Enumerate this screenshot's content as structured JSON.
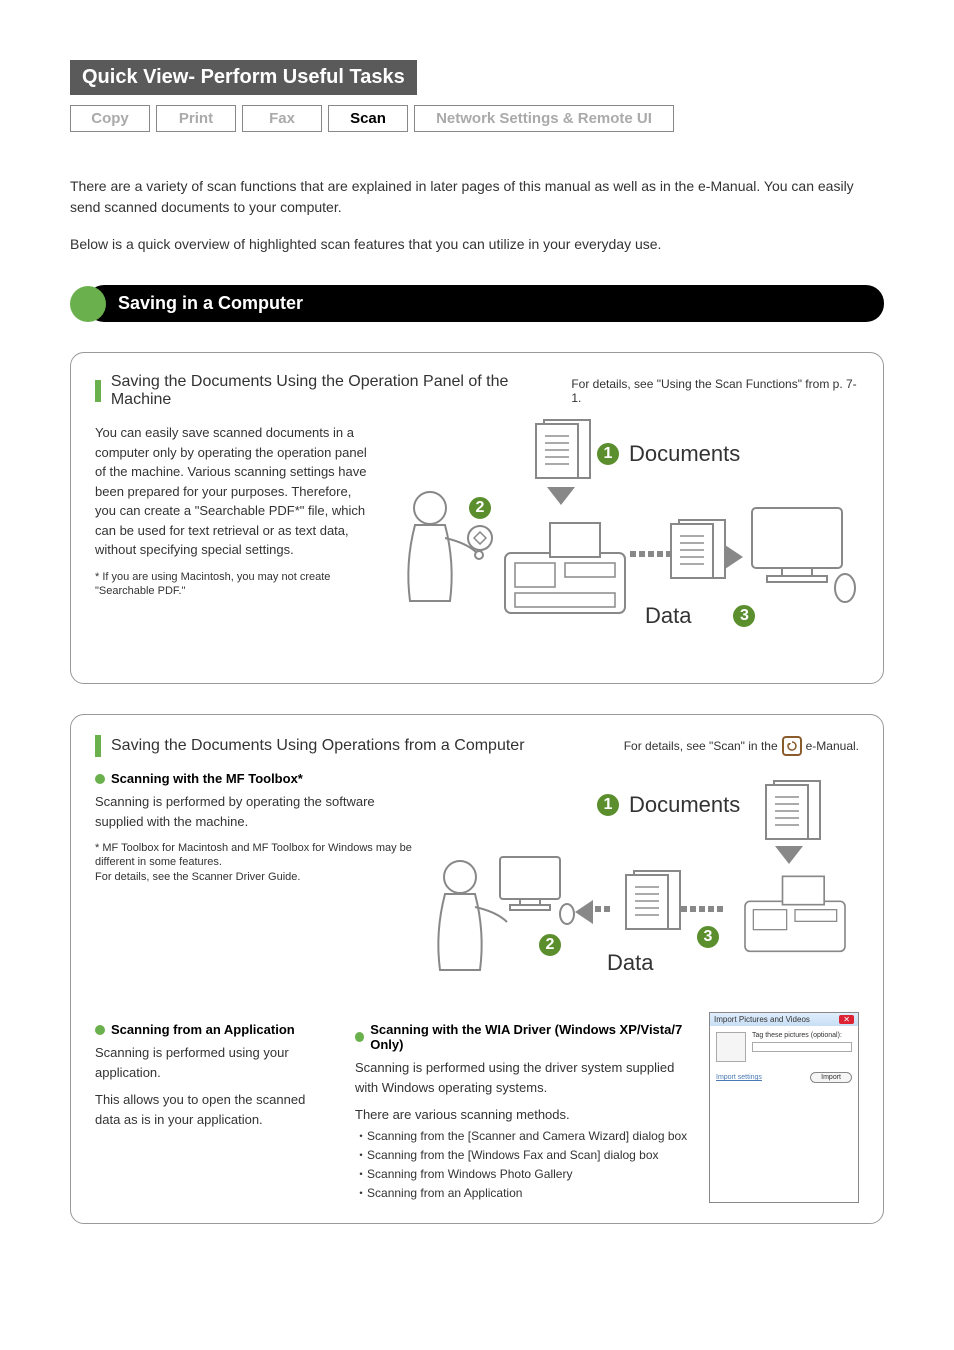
{
  "header": {
    "title": "Quick View- Perform Useful Tasks",
    "tabs": [
      "Copy",
      "Print",
      "Fax",
      "Scan",
      "Network Settings & Remote UI"
    ],
    "active_tab_index": 3
  },
  "intro": {
    "p1": "There are a variety of scan functions that are explained in later pages of this manual as well as in the e-Manual. You can easily send scanned documents to your computer.",
    "p2": "Below is a quick overview of highlighted scan features that you can utilize in your everyday use."
  },
  "section_title": "Saving in a Computer",
  "card1": {
    "title": "Saving the Documents Using the Operation Panel of the Machine",
    "detail": "For details, see \"Using the Scan Functions\" from p. 7-1.",
    "text": "You can easily save scanned documents in a computer only by operating the operation panel of the machine. Various scanning settings have been prepared for your purposes. Therefore, you can create a \"Searchable PDF*\" file, which can be used for text retrieval or as text data, without specifying special settings.",
    "footnote": "* If you are using Macintosh, you may not create \"Searchable PDF.\"",
    "label_documents": "Documents",
    "label_data": "Data",
    "n1": "1",
    "n2": "2",
    "n3": "3"
  },
  "card2": {
    "title": "Saving the Documents Using Operations from a Computer",
    "detail_pre": "For details, see \"Scan\" in the",
    "detail_post": "e-Manual.",
    "sub1_title": "Scanning with the MF Toolbox*",
    "sub1_text": "Scanning is performed by operating the software supplied with the machine.",
    "sub1_foot1": "* MF Toolbox for Macintosh and MF Toolbox for Windows may be different in some features.",
    "sub1_foot2": "  For details, see the Scanner Driver Guide.",
    "label_documents": "Documents",
    "label_data": "Data",
    "n1": "1",
    "n2": "2",
    "n3": "3",
    "subA_title": "Scanning from an Application",
    "subA_text1": "Scanning is performed using your application.",
    "subA_text2": "This allows you to open the scanned data as is in your application.",
    "subB_title": "Scanning with the WIA Driver (Windows XP/Vista/7 Only)",
    "subB_text1": "Scanning is performed using the driver system supplied with Windows operating systems.",
    "subB_text2": "There are various scanning methods.",
    "subB_items": [
      "Scanning from the [Scanner and Camera Wizard] dialog box",
      "Scanning from the [Windows Fax and Scan] dialog box",
      "Scanning from Windows Photo Gallery",
      "Scanning from an Application"
    ],
    "wia": {
      "title": "Import Pictures and Videos",
      "tag_label": "Tag these pictures (optional):",
      "import_settings": "Import settings",
      "import_btn": "Import"
    }
  }
}
